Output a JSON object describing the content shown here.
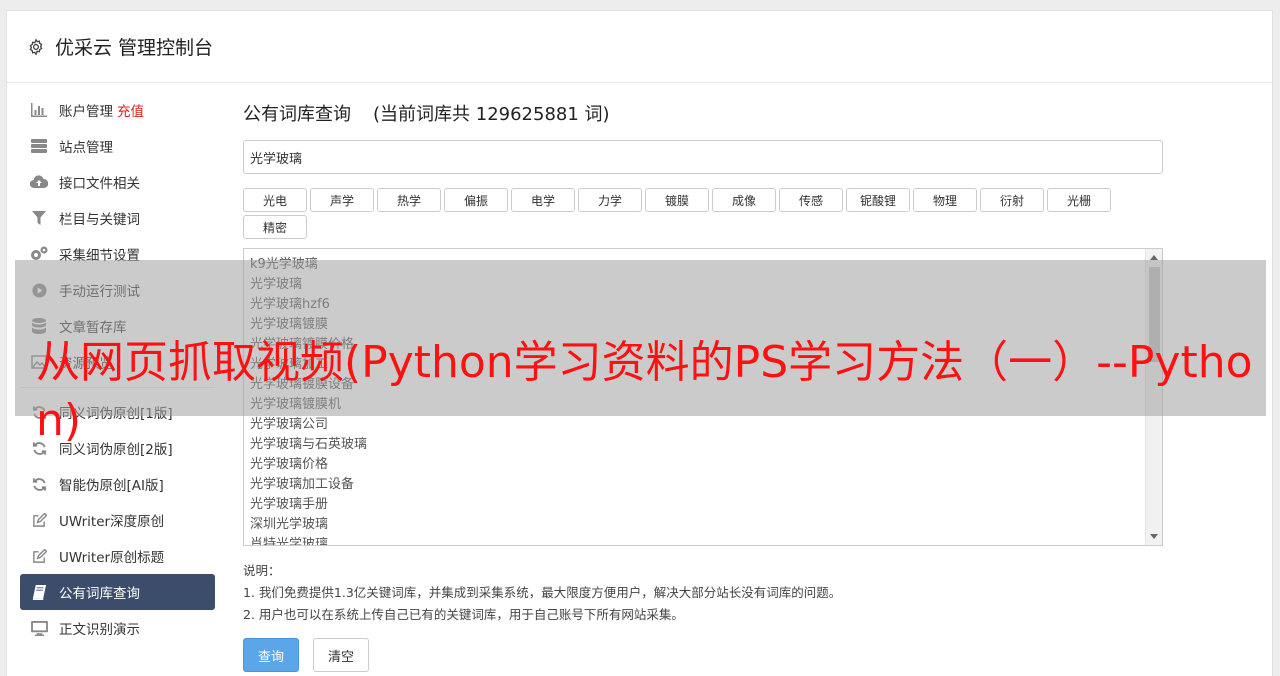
{
  "header": {
    "title": "优采云 管理控制台"
  },
  "sidebar": {
    "items": [
      {
        "label": "账户管理",
        "extra": "充值",
        "icon": "bar-chart-icon"
      },
      {
        "label": "站点管理",
        "icon": "server-icon"
      },
      {
        "label": "接口文件相关",
        "icon": "cloud-upload-icon"
      },
      {
        "label": "栏目与关键词",
        "icon": "filter-icon"
      },
      {
        "label": "采集细节设置",
        "icon": "gears-icon"
      },
      {
        "label": "手动运行测试",
        "icon": "play-circle-icon"
      },
      {
        "label": "文章暂存库",
        "icon": "database-icon"
      },
      {
        "label": "资源预览",
        "icon": "image-icon"
      }
    ],
    "items2": [
      {
        "label": "同义词伪原创[1版]",
        "icon": "refresh-icon"
      },
      {
        "label": "同义词伪原创[2版]",
        "icon": "refresh-icon"
      },
      {
        "label": "智能伪原创[AI版]",
        "icon": "refresh-icon"
      },
      {
        "label": "UWriter深度原创",
        "icon": "edit-icon"
      },
      {
        "label": "UWriter原创标题",
        "icon": "edit-icon"
      },
      {
        "label": "公有词库查询",
        "icon": "book-icon",
        "active": true
      },
      {
        "label": "正文识别演示",
        "icon": "monitor-icon"
      }
    ]
  },
  "main": {
    "title": "公有词库查询",
    "count_text": "(当前词库共 129625881 词)",
    "search_value": "光学玻璃",
    "tags": [
      "光电",
      "声学",
      "热学",
      "偏振",
      "电学",
      "力学",
      "镀膜",
      "成像",
      "传感",
      "铌酸锂",
      "物理",
      "衍射",
      "光栅",
      "精密"
    ],
    "results": [
      "k9光学玻璃",
      "光学玻璃",
      "光学玻璃hzf6",
      "光学玻璃镀膜",
      "光学玻璃镀膜价格",
      "光学玻璃加工",
      "光学玻璃镀膜设备",
      "光学玻璃镀膜机",
      "光学玻璃公司",
      "光学玻璃与石英玻璃",
      "光学玻璃价格",
      "光学玻璃加工设备",
      "光学玻璃手册",
      "深圳光学玻璃",
      "肖特光学玻璃"
    ],
    "notes": [
      "说明：",
      "1. 我们免费提供1.3亿关键词库，并集成到采集系统，最大限度方便用户，解决大部分站长没有词库的问题。",
      "2. 用户也可以在系统上传自己已有的关键词库，用于自己账号下所有网站采集。"
    ],
    "query_button": "查询",
    "clear_button": "清空"
  },
  "overlay": {
    "text": "从网页抓取视频(Python学习资料的PS学习方法（一）--Python)"
  }
}
